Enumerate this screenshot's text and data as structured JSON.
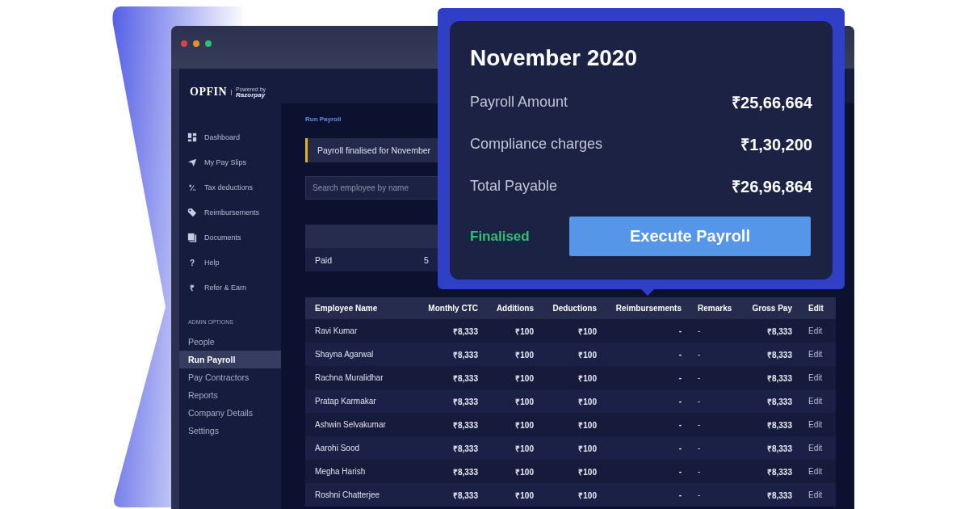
{
  "logo": {
    "brand": "OPFIN",
    "tagline": "Powered by",
    "partner": "Razorpay"
  },
  "sidebar": {
    "items": [
      {
        "label": "Dashboard",
        "selected": false
      },
      {
        "label": "My Pay Slips",
        "selected": false
      },
      {
        "label": "Tax deductions",
        "selected": false,
        "glyph": "⁺∕₋"
      },
      {
        "label": "Reimbursements",
        "selected": false
      },
      {
        "label": "Documents",
        "selected": false
      },
      {
        "label": "Help",
        "selected": false,
        "glyph": "?"
      },
      {
        "label": "Refer & Earn",
        "selected": false,
        "glyph": "₹"
      }
    ],
    "admin_heading": "ADMIN OPTIONS",
    "admin_items": [
      {
        "label": "People",
        "selected": false
      },
      {
        "label": "Run Payroll",
        "selected": true
      },
      {
        "label": "Pay Contractors",
        "selected": false
      },
      {
        "label": "Reports",
        "selected": false
      },
      {
        "label": "Company Details",
        "selected": false
      },
      {
        "label": "Settings",
        "selected": false
      }
    ]
  },
  "main": {
    "breadcrumb": "Run Payroll",
    "banner": "Payroll finalised for November",
    "search": {
      "placeholder": "Search employee by name"
    },
    "summary": {
      "rows": [
        {
          "label": "Paid",
          "value": "5"
        }
      ]
    },
    "table": {
      "columns": [
        "Employee Name",
        "Monthly CTC",
        "Additions",
        "Deductions",
        "Reimbursements",
        "Remarks",
        "Gross Pay",
        "Edit"
      ],
      "rows": [
        [
          "Ravi Kumar",
          "₹8,333",
          "₹100",
          "₹100",
          "-",
          "-",
          "₹8,333",
          "Edit"
        ],
        [
          "Shayna Agarwal",
          "₹8,333",
          "₹100",
          "₹100",
          "-",
          "-",
          "₹8,333",
          "Edit"
        ],
        [
          "Rachna Muralidhar",
          "₹8,333",
          "₹100",
          "₹100",
          "-",
          "-",
          "₹8,333",
          "Edit"
        ],
        [
          "Pratap Karmakar",
          "₹8,333",
          "₹100",
          "₹100",
          "-",
          "-",
          "₹8,333",
          "Edit"
        ],
        [
          "Ashwin Selvakumar",
          "₹8,333",
          "₹100",
          "₹100",
          "-",
          "-",
          "₹8,333",
          "Edit"
        ],
        [
          "Aarohi Sood",
          "₹8,333",
          "₹100",
          "₹100",
          "-",
          "-",
          "₹8,333",
          "Edit"
        ],
        [
          "Megha Harish",
          "₹8,333",
          "₹100",
          "₹100",
          "-",
          "-",
          "₹8,333",
          "Edit"
        ],
        [
          "Roshni Chatterjee",
          "₹8,333",
          "₹100",
          "₹100",
          "-",
          "-",
          "₹8,333",
          "Edit"
        ]
      ]
    }
  },
  "popup": {
    "title": "November 2020",
    "lines": [
      {
        "label": "Payroll Amount",
        "amount": "₹25,66,664"
      },
      {
        "label": "Compliance charges",
        "amount": "₹1,30,200"
      },
      {
        "label": "Total Payable",
        "amount": "₹26,96,864"
      }
    ],
    "status": "Finalised",
    "button": "Execute Payroll"
  }
}
